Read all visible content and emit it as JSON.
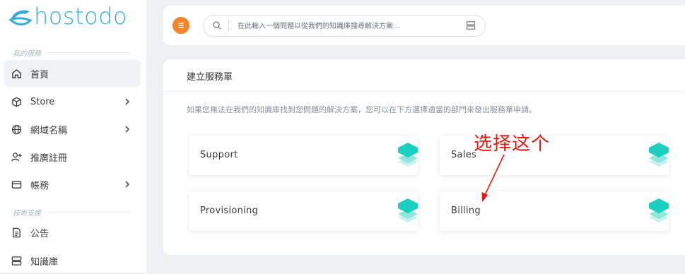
{
  "brand": {
    "name": "hostodo",
    "color": "#3aa9d6"
  },
  "sidebar": {
    "sections": [
      {
        "title": "我的服務"
      },
      {
        "title": "技術支援"
      }
    ],
    "items": [
      {
        "label": "首頁",
        "icon": "home-icon",
        "active": true
      },
      {
        "label": "Store",
        "icon": "box-icon",
        "has_submenu": true
      },
      {
        "label": "網域名稱",
        "icon": "globe-icon",
        "has_submenu": true
      },
      {
        "label": "推廣註冊",
        "icon": "user-plus-icon"
      },
      {
        "label": "帳務",
        "icon": "credit-card-icon",
        "has_submenu": true
      },
      {
        "label": "公告",
        "icon": "document-icon"
      },
      {
        "label": "知識庫",
        "icon": "server-icon"
      }
    ]
  },
  "topbar": {
    "menu_icon": "menu-icon",
    "menu_color": "#f5842b",
    "search": {
      "placeholder": "在此輸入一個問題以從我們的知識庫搜尋解決方案..."
    }
  },
  "card": {
    "title": "建立服務單",
    "description": "如果您無法在我們的知識庫找到您問題的解決方案，您可以在下方選擇適當的部門來發出服務單申請。",
    "departments": [
      {
        "label": "Support"
      },
      {
        "label": "Sales"
      },
      {
        "label": "Provisioning"
      },
      {
        "label": "Billing"
      }
    ],
    "accent_color": "#1ccfbf"
  },
  "annotation": {
    "text": "选择这个",
    "color": "#e8180e"
  }
}
